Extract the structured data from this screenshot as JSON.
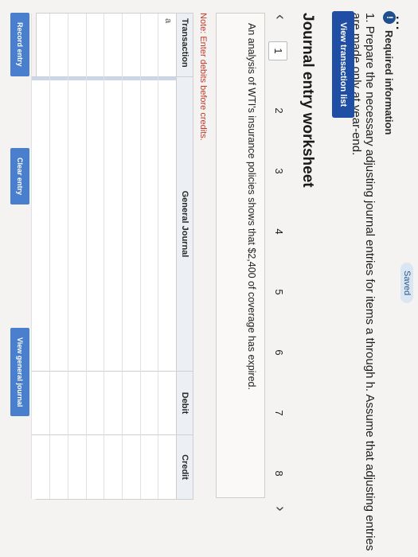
{
  "header": {
    "saved_label": "Saved",
    "cut_heading": "...",
    "info_icon": "info-circle-icon",
    "required_label": "Required information",
    "question": "1. Prepare the necessary adjusting journal entries for items a through h. Assume that adjusting entries are made only at year-end."
  },
  "actions": {
    "view_transaction_list": "View transaction list"
  },
  "worksheet": {
    "title": "Journal entry worksheet",
    "prev_icon": "chevron-left-icon",
    "next_icon": "chevron-right-icon",
    "pages": [
      "1",
      "2",
      "3",
      "4",
      "5",
      "6",
      "7",
      "8"
    ],
    "active_page": "1",
    "description": "An analysis of WTI's insurance policies shows that $2,400 of coverage has expired.",
    "note": "Note: Enter debits before credits."
  },
  "journal": {
    "columns": {
      "transaction": "Transaction",
      "general_journal": "General Journal",
      "debit": "Debit",
      "credit": "Credit"
    },
    "rows": [
      {
        "transaction": "a",
        "account": "",
        "debit": "",
        "credit": ""
      },
      {
        "transaction": "",
        "account": "",
        "debit": "",
        "credit": ""
      },
      {
        "transaction": "",
        "account": "",
        "debit": "",
        "credit": ""
      },
      {
        "transaction": "",
        "account": "",
        "debit": "",
        "credit": ""
      },
      {
        "transaction": "",
        "account": "",
        "debit": "",
        "credit": ""
      },
      {
        "transaction": "",
        "account": "",
        "debit": "",
        "credit": ""
      },
      {
        "transaction": "",
        "account": "",
        "debit": "",
        "credit": ""
      },
      {
        "transaction": "",
        "account": "",
        "debit": "",
        "credit": ""
      }
    ]
  },
  "buttons": {
    "record_entry": "Record entry",
    "clear_entry": "Clear entry",
    "view_general_journal": "View general journal"
  },
  "colors": {
    "primary_button": "#1f4ea4",
    "secondary_button": "#4a7fce",
    "note_text": "#c0392b"
  }
}
